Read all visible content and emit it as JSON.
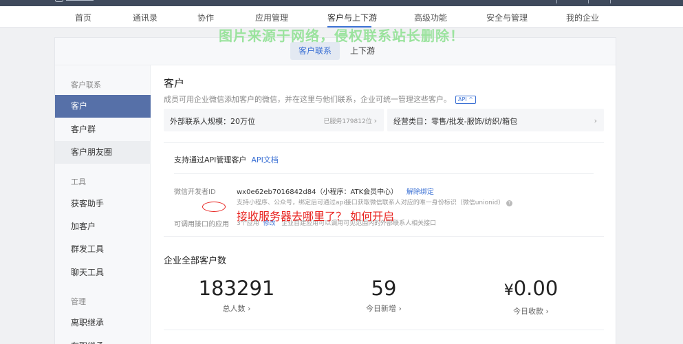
{
  "nav": {
    "items": [
      "首页",
      "通讯录",
      "协作",
      "应用管理",
      "客户与上下游",
      "高级功能",
      "安全与管理",
      "我的企业"
    ],
    "active_index": 4
  },
  "watermark": "图片来源于网络，侵权联系站长删除！",
  "subtabs": [
    "客户联系",
    "上下游"
  ],
  "sidebar": {
    "groups": [
      {
        "title": "客户联系",
        "items": [
          "客户",
          "客户群",
          "客户朋友圈"
        ]
      },
      {
        "title": "工具",
        "items": [
          "获客助手",
          "加客户",
          "群发工具",
          "聊天工具"
        ]
      },
      {
        "title": "管理",
        "items": [
          "离职继承",
          "在职继承"
        ]
      }
    ]
  },
  "main": {
    "title": "客户",
    "description": "成员可用企业微信添加客户的微信，并在这里与他们联系，企业可统一管理这些客户。",
    "api_badge": "API ^",
    "card_scale": {
      "label": "外部联系人规模：20万位",
      "meta": "已服务179812位"
    },
    "card_category": {
      "label": "经营类目：零售/批发-服饰/纺织/箱包"
    },
    "api_section": {
      "heading": "支持通过API管理客户",
      "doc_link": "API文档",
      "dev_id_label": "微信开发者ID",
      "dev_id_value": "wx0e62eb7016842d84（小程序：ATK会员中心）",
      "unbind_link": "解除绑定",
      "dev_id_hint": "支持小程序、公众号，绑定后可通过api接口获取微信联系人对应的唯一身份标识（微信unionid）",
      "apps_label": "可调用接口的应用",
      "apps_count": "3个应用",
      "apps_modify": "修改",
      "apps_hint": "企业自建应用可以调用可见范围内的外部联系人相关接口"
    },
    "annotation": "接收服务器去哪里了？ 如何开启",
    "stats_title": "企业全部客户数",
    "stats": [
      {
        "value": "183291",
        "caption": "总人数 ›"
      },
      {
        "value": "59",
        "caption": "今日新增 ›"
      },
      {
        "currency": "¥",
        "value": "0.00",
        "caption": "今日收款 ›"
      }
    ]
  },
  "colors": {
    "accent": "#3a70d4",
    "sidebar_active": "#5670a8",
    "annotation": "#e8231f",
    "watermark": "#9be39e"
  }
}
